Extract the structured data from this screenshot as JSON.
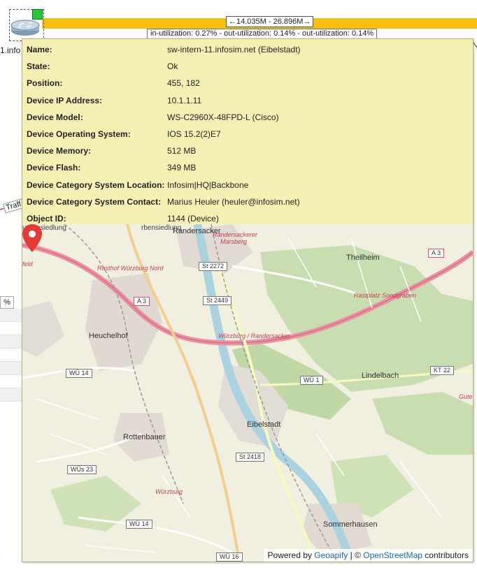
{
  "background": {
    "link_label": "←14.035M  -  26.896M→",
    "util_label": "in-utilization: 0.27%  -  out-utilization: 0.14%  -  out-utilization: 0.14%",
    "device_label": "1.info",
    "traffic_label": "Traff",
    "percent_cell": "%",
    "status_color": "#22c93a",
    "link_color": "#f7bf12",
    "icons": {
      "device": "router-icon",
      "status": "status-square"
    }
  },
  "tooltip": {
    "properties": [
      {
        "key": "Name:",
        "value": "sw-intern-11.infosim.net (Eibelstadt)"
      },
      {
        "key": "State:",
        "value": "Ok"
      },
      {
        "key": "Position:",
        "value": "455, 182"
      },
      {
        "key": "Device IP Address:",
        "value": "10.1.1.11"
      },
      {
        "key": "Device Model:",
        "value": "WS-C2960X-48FPD-L (Cisco)"
      },
      {
        "key": "Device Operating System:",
        "value": "IOS 15.2(2)E7"
      },
      {
        "key": "Device Memory:",
        "value": "512 MB"
      },
      {
        "key": "Device Flash:",
        "value": "349 MB"
      },
      {
        "key": "Device Category System Location:",
        "value": "Infosim|HQ|Backbone"
      },
      {
        "key": "Device Category System Contact:",
        "value": "Marius Heuler (heuler@infosim.net)"
      },
      {
        "key": "Object ID:",
        "value": "1144 (Device)"
      }
    ],
    "background_color": "#f5f1b5"
  },
  "map": {
    "places": {
      "randersacker": "Randersacker",
      "randersackerer": "Randersackerer",
      "marsberg": "Marsberg",
      "theilheim": "Theilheim",
      "heuchelhof": "Heuchelhof",
      "lindelbach": "Lindelbach",
      "eibelstadt": "Eibelstadt",
      "rottenbauer": "Rottenbauer",
      "sommerhausen": "Sommerhausen",
      "wurzburg": "Würzburg",
      "rasthof": "Rasthof Würzburg Nord",
      "rastplatz": "Rastplatz Sondgraben",
      "junction": "Würzburg / Randersacker",
      "gute": "Gute",
      "feld": "feld",
      "siedlung": "rbensiedlung",
      "vorstadt": "urbensiedlung"
    },
    "roads": {
      "a3_left": "A 3",
      "a3_right": "A 3",
      "st2272": "St 2272",
      "st2449": "St 2449",
      "st2418": "St 2418",
      "wu14_top": "WÜ 14",
      "wu14_bottom": "WÜ 14",
      "wu1": "WÜ 1",
      "wu23": "WÜs 23",
      "wu16": "WÜ 16",
      "kt22": "KT 22"
    },
    "marker_color": "#e53935",
    "attribution": {
      "prefix": "Powered by ",
      "geoapify": "Geoapify",
      "sep": " | © ",
      "osm": "OpenStreetMap",
      "suffix": " contributors"
    }
  }
}
